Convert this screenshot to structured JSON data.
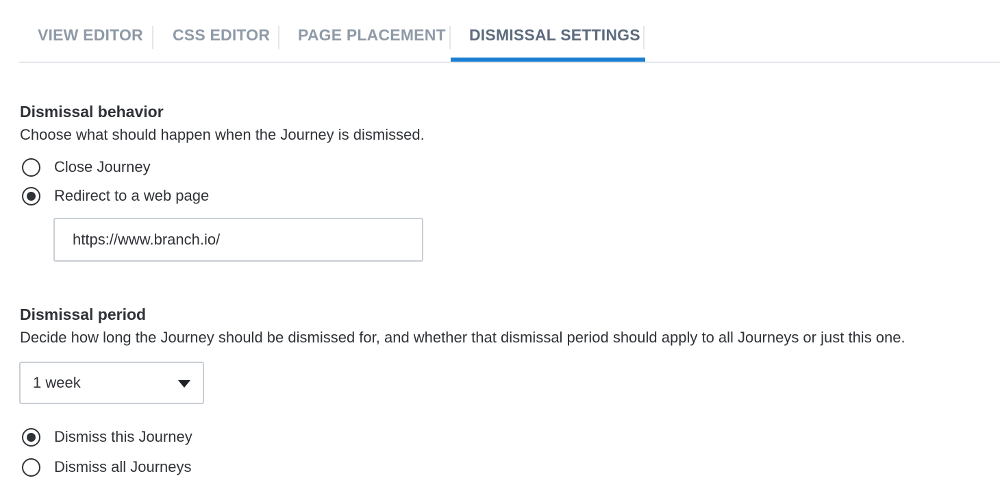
{
  "tabs": [
    {
      "label": "VIEW EDITOR",
      "active": false
    },
    {
      "label": "CSS EDITOR",
      "active": false
    },
    {
      "label": "PAGE PLACEMENT",
      "active": false
    },
    {
      "label": "DISMISSAL SETTINGS",
      "active": true
    }
  ],
  "behavior": {
    "heading": "Dismissal behavior",
    "description": "Choose what should happen when the Journey is dismissed.",
    "options": [
      {
        "label": "Close Journey",
        "selected": false
      },
      {
        "label": "Redirect to a web page",
        "selected": true
      }
    ],
    "url_value": "https://www.branch.io/"
  },
  "period": {
    "heading": "Dismissal period",
    "description": "Decide how long the Journey should be dismissed for, and whether that dismissal period should apply to all Journeys or just this one.",
    "duration_selected": "1 week",
    "options": [
      {
        "label": "Dismiss this Journey",
        "selected": true
      },
      {
        "label": "Dismiss all Journeys",
        "selected": false
      }
    ]
  },
  "colors": {
    "accent": "#1a7fd2",
    "tab_inactive": "#8f9aa7",
    "tab_active": "#5c6b7d",
    "text": "#2f3237",
    "border": "#c9ced5"
  }
}
